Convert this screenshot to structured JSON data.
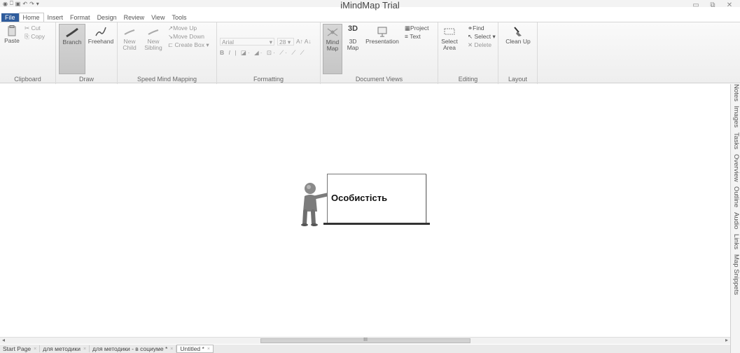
{
  "window": {
    "title": "iMindMap Trial",
    "controls": [
      "▭",
      "⧉",
      "✕"
    ]
  },
  "tabs": [
    "File",
    "Home",
    "Insert",
    "Format",
    "Design",
    "Review",
    "View",
    "Tools"
  ],
  "ribbon": {
    "clipboard": {
      "label": "Clipboard",
      "paste": "Paste",
      "cut": "Cut",
      "copy": "Copy"
    },
    "draw": {
      "label": "Draw",
      "branch": "Branch",
      "freehand": "Freehand"
    },
    "speed": {
      "label": "Speed Mind Mapping",
      "new_child": "New Child",
      "new_sibling": "New Sibling",
      "move_up": "Move Up",
      "move_down": "Move Down",
      "create_box": "Create Box"
    },
    "formatting": {
      "label": "Formatting",
      "font": "Arial",
      "size": "28"
    },
    "views": {
      "label": "Document Views",
      "mind_map": "Mind Map",
      "map_3d": "3D Map",
      "presentation": "Presentation",
      "project": "Project",
      "text": "Text"
    },
    "editing": {
      "label": "Editing",
      "select_area": "Select Area",
      "find": "Find",
      "select": "Select",
      "delete": "Delete"
    },
    "layout": {
      "label": "Layout",
      "clean_up": "Clean Up"
    }
  },
  "side_tabs": [
    "Notes",
    "Images",
    "Tasks",
    "Overview",
    "Outline",
    "Audio",
    "Links",
    "Map Snippets"
  ],
  "central_topic": "Особистість",
  "doc_tabs": [
    {
      "label": "Start Page",
      "active": false
    },
    {
      "label": "для методики",
      "active": false
    },
    {
      "label": "для методики - в социуме *",
      "active": false
    },
    {
      "label": "Untitled *",
      "active": true
    }
  ],
  "scrollbar_grip": "III"
}
